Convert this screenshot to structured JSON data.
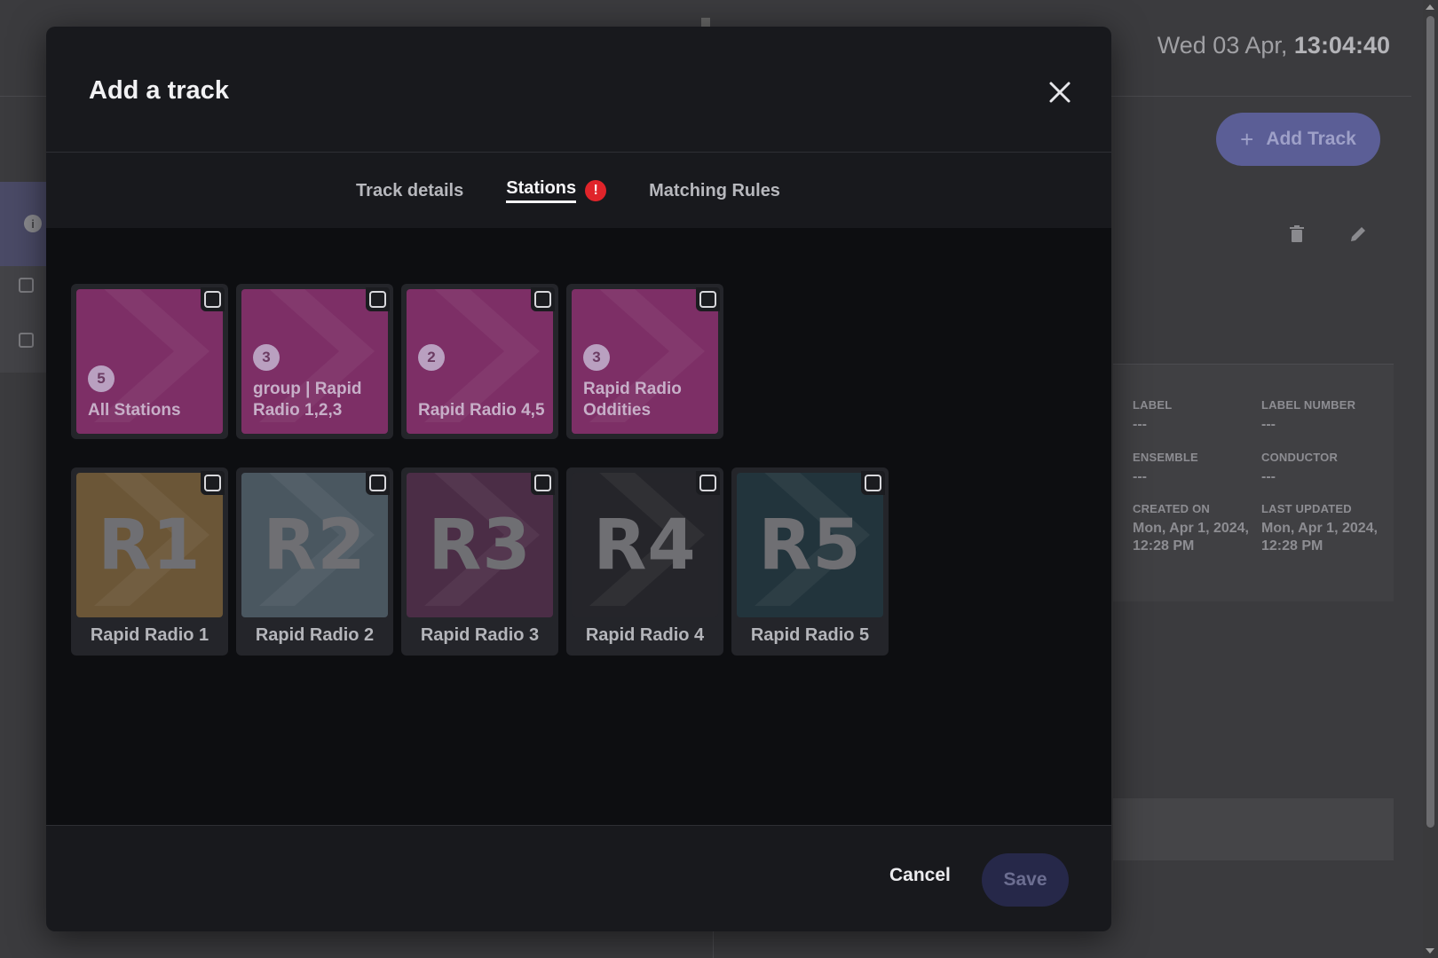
{
  "background": {
    "datetime_prefix": "Wed 03 Apr,",
    "datetime_time": "13:04:40",
    "add_track_label": "Add Track",
    "details": {
      "label_title": "LABEL",
      "label_value": "---",
      "label_number_title": "LABEL NUMBER",
      "label_number_value": "---",
      "ensemble_title": "ENSEMBLE",
      "ensemble_value": "---",
      "conductor_title": "CONDUCTOR",
      "conductor_value": "---",
      "created_on_title": "CREATED ON",
      "created_on_value": "Mon, Apr 1, 2024, 12:28 PM",
      "last_updated_title": "LAST UPDATED",
      "last_updated_value": "Mon, Apr 1, 2024, 12:28 PM"
    }
  },
  "modal": {
    "title": "Add a track",
    "tabs": [
      {
        "label": "Track details",
        "active": false
      },
      {
        "label": "Stations",
        "active": true,
        "error_badge": "!"
      },
      {
        "label": "Matching Rules",
        "active": false
      }
    ],
    "groups": [
      {
        "count": "5",
        "name": "All Stations",
        "checked": false
      },
      {
        "count": "3",
        "name": "group | Rapid Radio 1,2,3",
        "checked": false
      },
      {
        "count": "2",
        "name": "Rapid Radio 4,5",
        "checked": false
      },
      {
        "count": "3",
        "name": "Rapid Radio Oddities",
        "checked": false
      }
    ],
    "stations": [
      {
        "code": "R1",
        "name": "Rapid Radio 1",
        "color": "#6b5637",
        "checked": false
      },
      {
        "code": "R2",
        "name": "Rapid Radio 2",
        "color": "#4a5760",
        "checked": false
      },
      {
        "code": "R3",
        "name": "Rapid Radio 3",
        "color": "#4b2d46",
        "checked": false
      },
      {
        "code": "R4",
        "name": "Rapid Radio 4",
        "color": "#25252a",
        "checked": false
      },
      {
        "code": "R5",
        "name": "Rapid Radio 5",
        "color": "#22343c",
        "checked": false
      }
    ],
    "cancel_label": "Cancel",
    "save_label": "Save"
  },
  "colors": {
    "group_tile": "#7d2f66",
    "error_badge": "#e0242a",
    "save_disabled": "#262849"
  },
  "icons": {
    "close": "close-icon",
    "plus": "plus-icon",
    "trash": "trash-icon",
    "edit": "pencil-icon",
    "info": "info-icon"
  }
}
